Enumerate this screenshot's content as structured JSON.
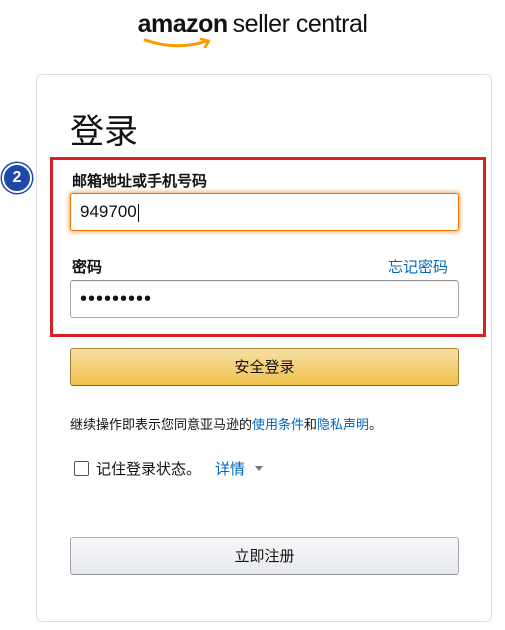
{
  "logo": {
    "brand": "amazon",
    "subtitle": "seller central"
  },
  "step_badge": "2",
  "signin": {
    "title": "登录",
    "email_label": "邮箱地址或手机号码",
    "email_value": "949700",
    "password_label": "密码",
    "forgot_link": "忘记密码",
    "password_value": "•••••••••",
    "submit_label": "安全登录"
  },
  "legal": {
    "prefix": "继续操作即表示您同意亚马逊的",
    "terms_link": "使用条件",
    "and": "和",
    "privacy_link": "隐私声明",
    "suffix": "。"
  },
  "remember": {
    "label": "记住登录状态。",
    "details_link": "详情"
  },
  "register_label": "立即注册",
  "colors": {
    "highlight_border": "#d82028",
    "badge": "#1f49a8",
    "link": "#0066c0",
    "signin_button": "#f0c14b",
    "focus_border": "#e77600"
  }
}
